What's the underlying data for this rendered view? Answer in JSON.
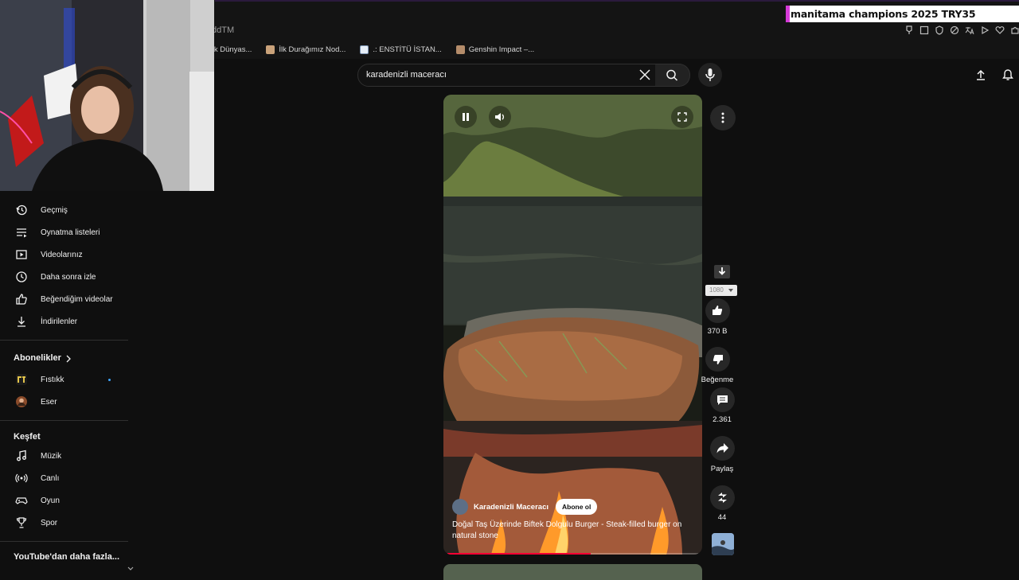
{
  "browser": {
    "tab_fragment": "ddTM",
    "bookmarks": [
      {
        "label": "ick Dünyas...",
        "icon": "bookmark-icon"
      },
      {
        "label": "İlk Durağımız Nod...",
        "icon": "bookmark-icon"
      },
      {
        "label": ".: ENSTİTÜ İSTAN...",
        "icon": "bookmark-icon"
      },
      {
        "label": "Genshin Impact –...",
        "icon": "bookmark-icon"
      }
    ]
  },
  "overlay_banner": {
    "text": "manitama champions 2025 TRY35",
    "accent": "#d63ad8"
  },
  "search": {
    "query": "karadenizli maceracı"
  },
  "sidebar": {
    "you_items": [
      {
        "label": "Geçmiş",
        "icon": "history-icon"
      },
      {
        "label": "Oynatma listeleri",
        "icon": "playlist-icon"
      },
      {
        "label": "Videolarınız",
        "icon": "your-videos-icon"
      },
      {
        "label": "Daha sonra izle",
        "icon": "watch-later-icon"
      },
      {
        "label": "Beğendiğim videolar",
        "icon": "thumb-up-icon"
      },
      {
        "label": "İndirilenler",
        "icon": "download-icon"
      }
    ],
    "subscriptions_header": "Abonelikler",
    "subscriptions": [
      {
        "label": "Fıstıkk",
        "icon": "channel-avatar",
        "new_content": true
      },
      {
        "label": "Eser",
        "icon": "channel-avatar",
        "new_content": false
      }
    ],
    "explore_header": "Keşfet",
    "explore_items": [
      {
        "label": "Müzik",
        "icon": "music-icon"
      },
      {
        "label": "Canlı",
        "icon": "live-icon"
      },
      {
        "label": "Oyun",
        "icon": "gaming-icon"
      },
      {
        "label": "Spor",
        "icon": "trophy-icon"
      }
    ],
    "more_header": "YouTube'dan daha fazla..."
  },
  "short": {
    "channel_name": "Karadenizli Maceracı",
    "subscribe_label": "Abone ol",
    "title": "Doğal Taş Üzerinde Biftek Dolgulu Burger - Steak-filled burger on natural stone",
    "progress_fraction": 0.57
  },
  "actions": {
    "quality": "1080",
    "like_count": "370 B",
    "dislike_label": "Beğenme",
    "comment_count": "2.361",
    "share_label": "Paylaş",
    "remix_count": "44"
  },
  "colors": {
    "background": "#0f0f0f",
    "progress": "#ff0033",
    "accent_dot": "#3ea6ff"
  }
}
